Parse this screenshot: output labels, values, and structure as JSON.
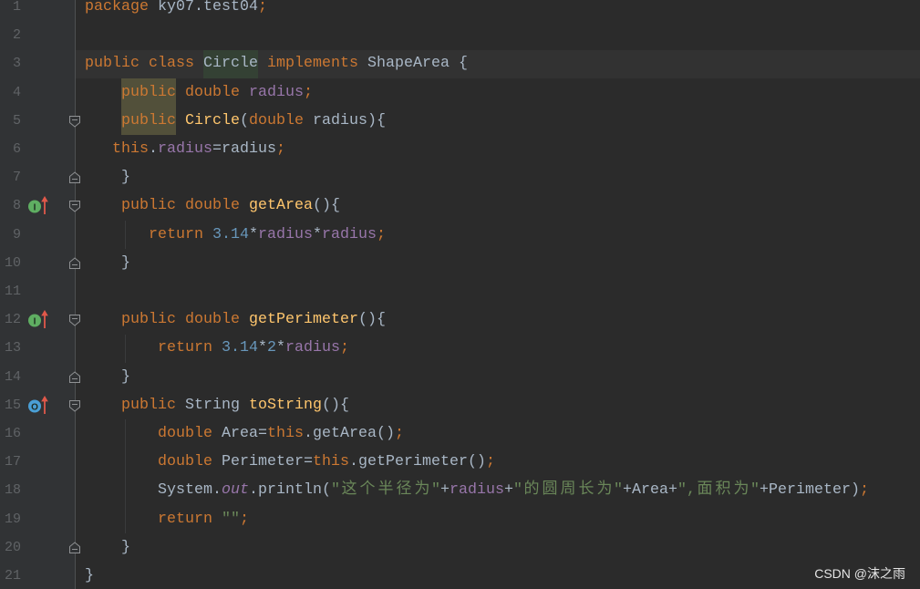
{
  "editor": {
    "theme": {
      "editor_bg": "#2B2B2B",
      "gutter_bg": "#313335",
      "caret_row_bg": "#323232",
      "line_number": "#606366"
    },
    "caret_line": 3,
    "lines": [
      {
        "number": "1",
        "indent": 0,
        "tokens": [
          {
            "t": "package",
            "c": "#CC7832"
          },
          {
            "t": " ky07.test04",
            "c": "#A9B7C6"
          },
          {
            "t": ";",
            "c": "#CC7832"
          }
        ]
      },
      {
        "number": "2",
        "indent": 0,
        "tokens": []
      },
      {
        "number": "3",
        "indent": 0,
        "tokens": [
          {
            "t": "public class ",
            "c": "#CC7832"
          },
          {
            "t": "Circle",
            "c": "#A9B7C6",
            "bg": "#344134"
          },
          {
            "t": " implements ",
            "c": "#CC7832"
          },
          {
            "t": "ShapeArea {",
            "c": "#A9B7C6"
          }
        ]
      },
      {
        "number": "4",
        "indent": 4,
        "tokens": [
          {
            "t": "public",
            "c": "#CC7832",
            "bg": "#52503A"
          },
          {
            "t": " double ",
            "c": "#CC7832"
          },
          {
            "t": "radius",
            "c": "#9876AA"
          },
          {
            "t": ";",
            "c": "#CC7832"
          }
        ]
      },
      {
        "number": "5",
        "indent": 4,
        "fold": "fold-start-icon",
        "tokens": [
          {
            "t": "public",
            "c": "#CC7832",
            "bg": "#52503A"
          },
          {
            "t": " Circle",
            "c": "#FFC66D"
          },
          {
            "t": "(",
            "c": "#A9B7C6"
          },
          {
            "t": "double",
            "c": "#CC7832"
          },
          {
            "t": " radius){",
            "c": "#A9B7C6"
          }
        ]
      },
      {
        "number": "6",
        "indent": 3,
        "tokens": [
          {
            "t": "this",
            "c": "#CC7832"
          },
          {
            "t": ".",
            "c": "#A9B7C6"
          },
          {
            "t": "radius",
            "c": "#9876AA"
          },
          {
            "t": "=radius",
            "c": "#A9B7C6"
          },
          {
            "t": ";",
            "c": "#CC7832"
          }
        ]
      },
      {
        "number": "7",
        "indent": 4,
        "fold": "fold-end-icon",
        "tokens": [
          {
            "t": "}",
            "c": "#A9B7C6"
          }
        ]
      },
      {
        "number": "8",
        "indent": 4,
        "fold": "fold-start-icon",
        "gutter": {
          "icon": "implements-method-icon",
          "letter": "I",
          "color": "#5FAE62"
        },
        "tokens": [
          {
            "t": "public double ",
            "c": "#CC7832"
          },
          {
            "t": "getArea",
            "c": "#FFC66D"
          },
          {
            "t": "(){",
            "c": "#A9B7C6"
          }
        ]
      },
      {
        "number": "9",
        "indent": 7,
        "tokens": [
          {
            "t": "return ",
            "c": "#CC7832"
          },
          {
            "t": "3.14",
            "c": "#6897BB"
          },
          {
            "t": "*",
            "c": "#A9B7C6"
          },
          {
            "t": "radius",
            "c": "#9876AA"
          },
          {
            "t": "*",
            "c": "#A9B7C6"
          },
          {
            "t": "radius",
            "c": "#9876AA"
          },
          {
            "t": ";",
            "c": "#CC7832"
          }
        ]
      },
      {
        "number": "10",
        "indent": 4,
        "fold": "fold-end-icon",
        "tokens": [
          {
            "t": "}",
            "c": "#A9B7C6"
          }
        ]
      },
      {
        "number": "11",
        "indent": 0,
        "tokens": []
      },
      {
        "number": "12",
        "indent": 4,
        "fold": "fold-start-icon",
        "gutter": {
          "icon": "implements-method-icon",
          "letter": "I",
          "color": "#5FAE62"
        },
        "tokens": [
          {
            "t": "public double ",
            "c": "#CC7832"
          },
          {
            "t": "getPerimeter",
            "c": "#FFC66D"
          },
          {
            "t": "(){",
            "c": "#A9B7C6"
          }
        ]
      },
      {
        "number": "13",
        "indent": 8,
        "tokens": [
          {
            "t": "return ",
            "c": "#CC7832"
          },
          {
            "t": "3.14",
            "c": "#6897BB"
          },
          {
            "t": "*",
            "c": "#A9B7C6"
          },
          {
            "t": "2",
            "c": "#6897BB"
          },
          {
            "t": "*",
            "c": "#A9B7C6"
          },
          {
            "t": "radius",
            "c": "#9876AA"
          },
          {
            "t": ";",
            "c": "#CC7832"
          }
        ]
      },
      {
        "number": "14",
        "indent": 4,
        "fold": "fold-end-icon",
        "tokens": [
          {
            "t": "}",
            "c": "#A9B7C6"
          }
        ]
      },
      {
        "number": "15",
        "indent": 4,
        "fold": "fold-start-icon",
        "gutter": {
          "icon": "overrides-method-icon",
          "letter": "O",
          "color": "#4A9FD5"
        },
        "tokens": [
          {
            "t": "public ",
            "c": "#CC7832"
          },
          {
            "t": "String ",
            "c": "#A9B7C6"
          },
          {
            "t": "toString",
            "c": "#FFC66D"
          },
          {
            "t": "(){",
            "c": "#A9B7C6"
          }
        ]
      },
      {
        "number": "16",
        "indent": 8,
        "tokens": [
          {
            "t": "double ",
            "c": "#CC7832"
          },
          {
            "t": "Area=",
            "c": "#A9B7C6"
          },
          {
            "t": "this",
            "c": "#CC7832"
          },
          {
            "t": ".getArea()",
            "c": "#A9B7C6"
          },
          {
            "t": ";",
            "c": "#CC7832"
          }
        ]
      },
      {
        "number": "17",
        "indent": 8,
        "tokens": [
          {
            "t": "double ",
            "c": "#CC7832"
          },
          {
            "t": "Perimeter=",
            "c": "#A9B7C6"
          },
          {
            "t": "this",
            "c": "#CC7832"
          },
          {
            "t": ".getPerimeter()",
            "c": "#A9B7C6"
          },
          {
            "t": ";",
            "c": "#CC7832"
          }
        ]
      },
      {
        "number": "18",
        "indent": 8,
        "tokens": [
          {
            "t": "System.",
            "c": "#A9B7C6"
          },
          {
            "t": "out",
            "c": "#9876AA",
            "i": true
          },
          {
            "t": ".println(",
            "c": "#A9B7C6"
          },
          {
            "t": "\"这个半径为\"",
            "c": "#6A8759"
          },
          {
            "t": "+",
            "c": "#A9B7C6"
          },
          {
            "t": "radius",
            "c": "#9876AA"
          },
          {
            "t": "+",
            "c": "#A9B7C6"
          },
          {
            "t": "\"的圆周长为\"",
            "c": "#6A8759"
          },
          {
            "t": "+Area+",
            "c": "#A9B7C6"
          },
          {
            "t": "\",面积为\"",
            "c": "#6A8759"
          },
          {
            "t": "+Perimeter)",
            "c": "#A9B7C6"
          },
          {
            "t": ";",
            "c": "#CC7832"
          }
        ]
      },
      {
        "number": "19",
        "indent": 8,
        "tokens": [
          {
            "t": "return ",
            "c": "#CC7832"
          },
          {
            "t": "\"\"",
            "c": "#6A8759"
          },
          {
            "t": ";",
            "c": "#CC7832"
          }
        ]
      },
      {
        "number": "20",
        "indent": 4,
        "fold": "fold-end-icon",
        "tokens": [
          {
            "t": "}",
            "c": "#A9B7C6"
          }
        ]
      },
      {
        "number": "21",
        "indent": 0,
        "tokens": [
          {
            "t": "}",
            "c": "#A9B7C6"
          }
        ]
      }
    ],
    "watermark": "CSDN @沫之雨"
  }
}
